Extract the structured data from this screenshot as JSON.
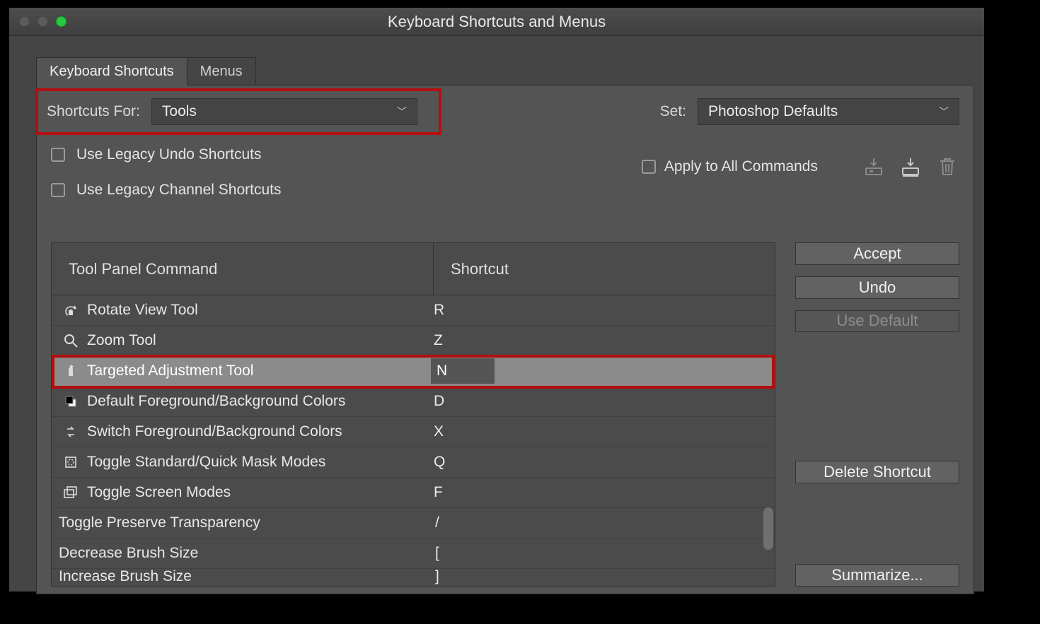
{
  "window": {
    "title": "Keyboard Shortcuts and Menus"
  },
  "tabs": {
    "shortcuts": "Keyboard Shortcuts",
    "menus": "Menus"
  },
  "dropdowns": {
    "shortcuts_for_label": "Shortcuts For:",
    "shortcuts_for_value": "Tools",
    "set_label": "Set:",
    "set_value": "Photoshop Defaults"
  },
  "checks": {
    "legacy_undo": "Use Legacy Undo Shortcuts",
    "legacy_channel": "Use Legacy Channel Shortcuts",
    "apply_all": "Apply to All Commands"
  },
  "table": {
    "col_command": "Tool Panel Command",
    "col_shortcut": "Shortcut",
    "rows": [
      {
        "name": "Rotate View Tool",
        "shortcut": "R"
      },
      {
        "name": "Zoom Tool",
        "shortcut": "Z"
      },
      {
        "name": "Targeted Adjustment Tool",
        "shortcut": "N"
      },
      {
        "name": "Default Foreground/Background Colors",
        "shortcut": "D"
      },
      {
        "name": "Switch Foreground/Background Colors",
        "shortcut": "X"
      },
      {
        "name": "Toggle Standard/Quick Mask Modes",
        "shortcut": "Q"
      },
      {
        "name": "Toggle Screen Modes",
        "shortcut": "F"
      },
      {
        "name": "Toggle Preserve Transparency",
        "shortcut": "/"
      },
      {
        "name": "Decrease Brush Size",
        "shortcut": "["
      },
      {
        "name": "Increase Brush Size",
        "shortcut": "]"
      }
    ]
  },
  "buttons": {
    "accept": "Accept",
    "undo": "Undo",
    "use_default": "Use Default",
    "delete": "Delete Shortcut",
    "summarize": "Summarize..."
  }
}
